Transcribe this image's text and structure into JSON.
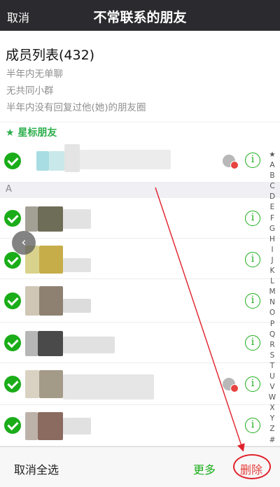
{
  "topbar": {
    "cancel": "取消",
    "title": "不常联系的朋友"
  },
  "summary": {
    "heading": "成员列表(432)",
    "criteria": [
      "半年内无单聊",
      "无共同小群",
      "半年内没有回复过他(她)的朋友圈"
    ]
  },
  "sections": {
    "starred": "★ 星标朋友",
    "a": "A"
  },
  "index": [
    "★",
    "A",
    "B",
    "C",
    "D",
    "E",
    "F",
    "G",
    "H",
    "I",
    "J",
    "K",
    "L",
    "M",
    "N",
    "O",
    "P",
    "Q",
    "R",
    "S",
    "T",
    "U",
    "V",
    "W",
    "X",
    "Y",
    "Z",
    "#"
  ],
  "info_glyph": "i",
  "back_glyph": "‹",
  "bottom": {
    "deselect": "取消全选",
    "more": "更多",
    "delete": "删除"
  },
  "colors": {
    "accent_green": "#1aad19",
    "title_bar": "#2b2b2f",
    "danger_red": "#e64340",
    "annotation_red": "#e0202a"
  }
}
